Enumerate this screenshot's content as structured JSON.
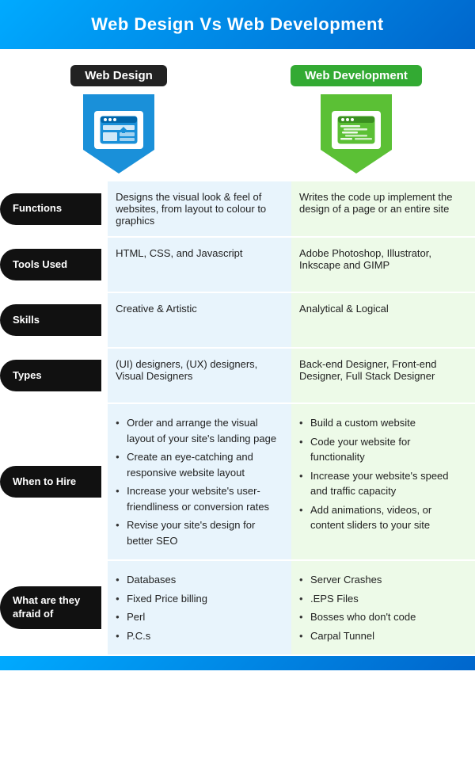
{
  "header": {
    "title": "Web Design  Vs  Web Development"
  },
  "columns": {
    "design_label": "Web Design",
    "dev_label": "Web Development"
  },
  "rows": [
    {
      "label": "Functions",
      "design": "Designs the visual look & feel of websites, from layout to colour to graphics",
      "dev": "Writes the code up implement the design of a page or an entire site",
      "type": "text"
    },
    {
      "label": "Tools Used",
      "design": "HTML, CSS, and Javascript",
      "dev": "Adobe Photoshop, Illustrator, Inkscape and GIMP",
      "type": "text"
    },
    {
      "label": "Skills",
      "design": "Creative & Artistic",
      "dev": "Analytical & Logical",
      "type": "text"
    },
    {
      "label": "Types",
      "design": "(UI) designers, (UX) designers, Visual Designers",
      "dev": "Back-end Designer, Front-end Designer, Full Stack Designer",
      "type": "text"
    },
    {
      "label": "When to Hire",
      "design_list": [
        "Order and arrange the visual layout of your site's landing page",
        "Create an eye-catching and responsive website layout",
        "Increase your website's user-friendliness or conversion rates",
        "Revise your site's design for better SEO"
      ],
      "dev_list": [
        "Build a custom website",
        "Code your website for functionality",
        "Increase your website's speed and traffic capacity",
        "Add animations, videos, or content sliders to your site"
      ],
      "type": "list"
    },
    {
      "label": "What are they afraid of",
      "design_list": [
        "Databases",
        "Fixed Price billing",
        "Perl",
        "P.C.s"
      ],
      "dev_list": [
        "Server Crashes",
        ".EPS Files",
        "Bosses who don't code",
        "Carpal Tunnel"
      ],
      "type": "list"
    }
  ]
}
